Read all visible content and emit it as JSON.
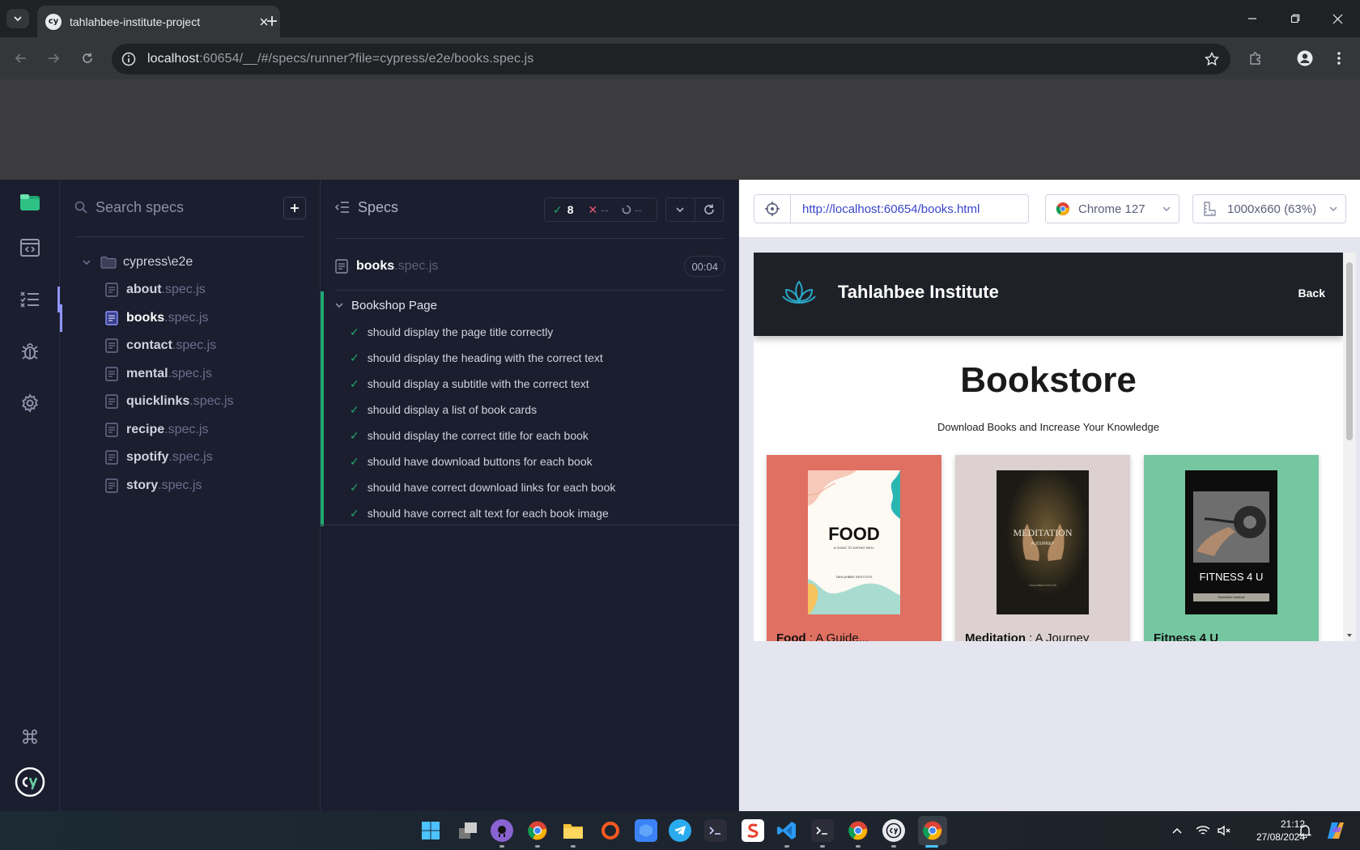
{
  "browser": {
    "tab_title": "tahlahbee-institute-project",
    "url_host": "localhost",
    "url_rest": ":60654/__/#/specs/runner?file=cypress/e2e/books.spec.js"
  },
  "sidebar": {
    "search_placeholder": "Search specs",
    "folder": "cypress\\e2e",
    "specs": [
      {
        "name": "about",
        "ext": ".spec.js"
      },
      {
        "name": "books",
        "ext": ".spec.js"
      },
      {
        "name": "contact",
        "ext": ".spec.js"
      },
      {
        "name": "mental",
        "ext": ".spec.js"
      },
      {
        "name": "quicklinks",
        "ext": ".spec.js"
      },
      {
        "name": "recipe",
        "ext": ".spec.js"
      },
      {
        "name": "spotify",
        "ext": ".spec.js"
      },
      {
        "name": "story",
        "ext": ".spec.js"
      }
    ]
  },
  "reporter": {
    "header": "Specs",
    "passed": "8",
    "failed": "--",
    "pending": "--",
    "file_name": "books",
    "file_ext": ".spec.js",
    "duration": "00:04",
    "suite": "Bookshop Page",
    "tests": [
      "should display the page title correctly",
      "should display the heading with the correct text",
      "should display a subtitle with the correct text",
      "should display a list of book cards",
      "should display the correct title for each book",
      "should have download buttons for each book",
      "should have correct download links for each book",
      "should have correct alt text for each book image"
    ]
  },
  "aut": {
    "url": "http://localhost:60654/books.html",
    "browser": "Chrome 127",
    "viewport": "1000x660 (63%)"
  },
  "site": {
    "name": "Tahlahbee Institute",
    "back": "Back",
    "heading": "Bookstore",
    "subtitle": "Download Books and Increase Your Knowledge",
    "books": [
      {
        "title": "Food",
        "rest": " : A Guide...",
        "cover_title": "FOOD",
        "cover_sub": "A GUIDE TO EATING WELL",
        "cover_pub": "TAHLAHBEE INSTITUTE",
        "bg": "#e07062"
      },
      {
        "title": "Meditation",
        "rest": " : A Journey",
        "cover_title": "MEDITATION",
        "cover_sub": "A JOURNEY",
        "cover_pub": "TAHLAHBEE INSTITUTE",
        "bg": "#dcd0d0"
      },
      {
        "title": "Fitness 4 U",
        "rest": "",
        "cover_title": "FITNESS 4 U",
        "cover_sub": "",
        "cover_pub": "Tahlahbee Institute",
        "bg": "#74c7a0"
      }
    ]
  },
  "taskbar": {
    "time": "21:12",
    "date": "27/08/2024"
  },
  "colors": {
    "accent": "#1fa971",
    "brand": "#9095ff",
    "link": "#3a46c9"
  }
}
